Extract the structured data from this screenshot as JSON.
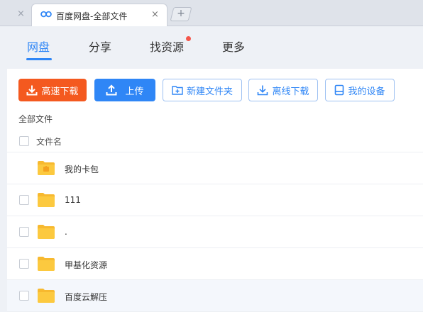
{
  "browser": {
    "prev_tab_close": "×",
    "active_tab_title": "百度网盘-全部文件",
    "active_tab_close": "×",
    "new_tab": "+"
  },
  "nav": {
    "items": [
      {
        "label": "网盘",
        "active": true
      },
      {
        "label": "分享",
        "active": false
      },
      {
        "label": "找资源",
        "active": false,
        "badge": "red-dot"
      },
      {
        "label": "更多",
        "active": false
      }
    ]
  },
  "toolbar": {
    "fast_download": "高速下载",
    "upload": "上传",
    "new_folder": "新建文件夹",
    "offline_download": "离线下载",
    "my_devices": "我的设备"
  },
  "breadcrumb": "全部文件",
  "list": {
    "column_header": "文件名",
    "rows": [
      {
        "name": "我的卡包",
        "icon": "wallet-folder-icon",
        "checkbox": false
      },
      {
        "name": "111",
        "icon": "folder-icon",
        "checkbox": true
      },
      {
        "name": ".",
        "icon": "folder-icon",
        "checkbox": true
      },
      {
        "name": "甲基化资源",
        "icon": "folder-icon",
        "checkbox": true
      },
      {
        "name": "百度云解压",
        "icon": "folder-icon",
        "checkbox": true,
        "highlighted": true
      }
    ]
  },
  "colors": {
    "accent": "#2f86f6",
    "orange": "#f4591f",
    "folder": "#fcc93f",
    "badge": "#f4564b"
  }
}
